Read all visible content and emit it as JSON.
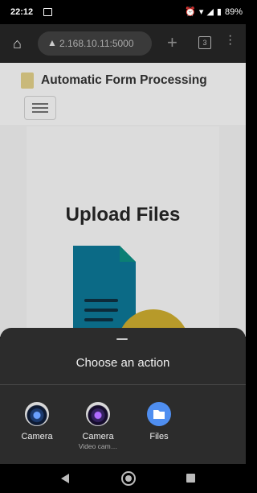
{
  "status": {
    "time": "22:12",
    "battery": "89%"
  },
  "browser": {
    "url": "2.168.10.11:5000",
    "tab_count": "3"
  },
  "page": {
    "brand": "Automatic Form Processing",
    "heading": "Upload Files"
  },
  "sheet": {
    "title": "Choose an action",
    "options": [
      {
        "label": "Camera",
        "sub": "",
        "icon": "camera-icon"
      },
      {
        "label": "Camera",
        "sub": "Video cam…",
        "icon": "video-camera-icon"
      },
      {
        "label": "Files",
        "sub": "",
        "icon": "folder-icon"
      }
    ]
  },
  "colors": {
    "doc_blue": "#0b6a86",
    "doc_fold": "#0b7f74",
    "upload_circle": "#b79a2a",
    "files_blue": "#4f8ef0"
  }
}
